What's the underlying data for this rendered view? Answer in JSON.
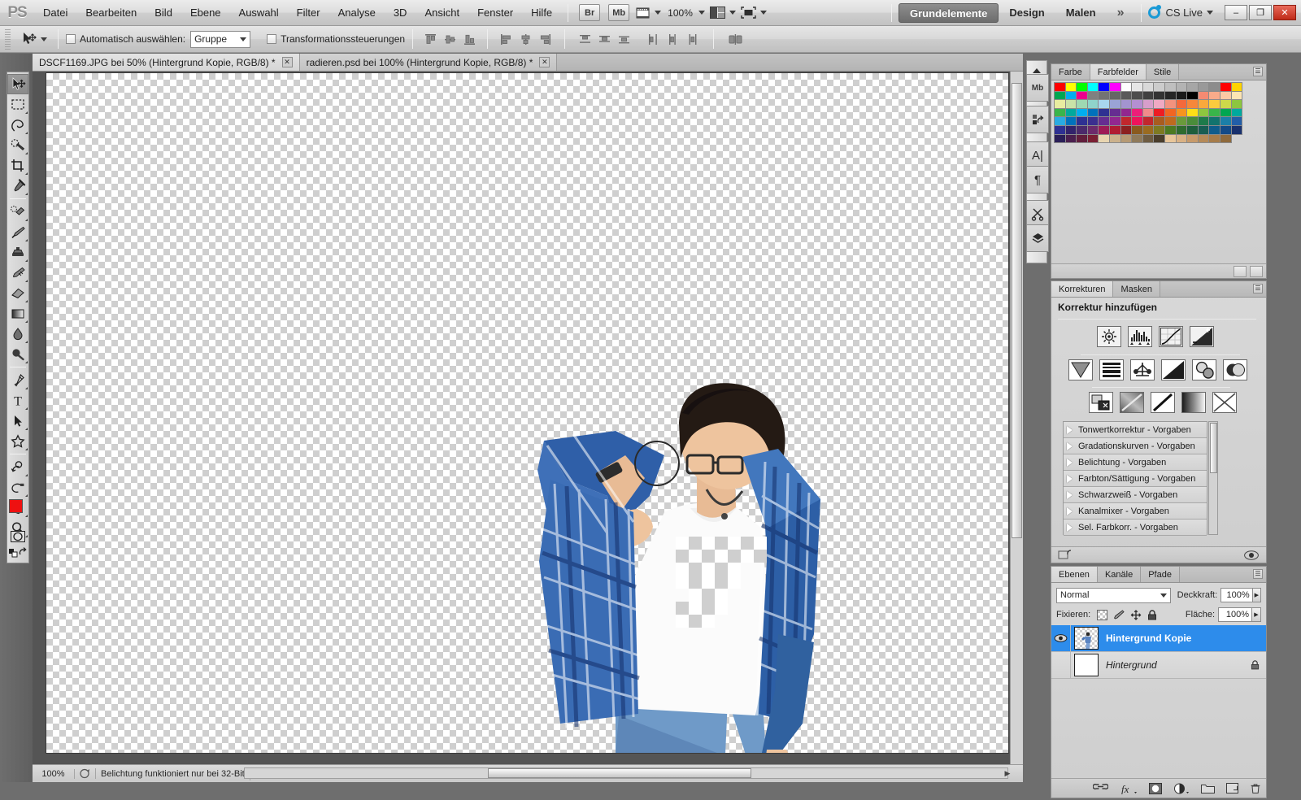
{
  "app": {
    "name": "Adobe Photoshop CS5",
    "logo_text": "PS"
  },
  "menubar": {
    "items": [
      "Datei",
      "Bearbeiten",
      "Bild",
      "Ebene",
      "Auswahl",
      "Filter",
      "Analyse",
      "3D",
      "Ansicht",
      "Fenster",
      "Hilfe"
    ],
    "bridge_label": "Br",
    "minibridge_label": "Mb",
    "zoom_level": "100%",
    "workspaces": [
      "Grundelemente",
      "Design",
      "Malen"
    ],
    "workspace_active": "Grundelemente",
    "more_workspaces": "»",
    "cs_live_label": "CS Live",
    "window_buttons": {
      "minimize": "–",
      "restore": "❐",
      "close": "✕"
    }
  },
  "optionsbar": {
    "tool_icon": "move-tool-icon",
    "auto_select_label": "Automatisch auswählen:",
    "auto_select_value": "Gruppe",
    "transform_controls_label": "Transformationssteuerungen",
    "align_icons": [
      "align-top-edges-icon",
      "align-vertical-centers-icon",
      "align-bottom-edges-icon",
      "align-left-edges-icon",
      "align-horizontal-centers-icon",
      "align-right-edges-icon",
      "distribute-top-icon",
      "distribute-vcenter-icon",
      "distribute-bottom-icon",
      "distribute-left-icon",
      "distribute-hcenter-icon",
      "distribute-right-icon",
      "auto-align-layers-icon"
    ]
  },
  "document_tabs": [
    {
      "title": "DSCF1169.JPG bei 50% (Hintergrund Kopie, RGB/8) *",
      "active": false,
      "close": "✕"
    },
    {
      "title": "radieren.psd bei 100% (Hintergrund Kopie, RGB/8) *",
      "active": true,
      "close": "✕"
    }
  ],
  "tools": {
    "groups": [
      [
        {
          "name": "move-tool",
          "selected": true,
          "sub": false
        },
        {
          "name": "rectangular-marquee-tool",
          "selected": false,
          "sub": true
        },
        {
          "name": "lasso-tool",
          "selected": false,
          "sub": true
        },
        {
          "name": "quick-selection-tool",
          "selected": false,
          "sub": true
        },
        {
          "name": "crop-tool",
          "selected": false,
          "sub": true
        },
        {
          "name": "eyedropper-tool",
          "selected": false,
          "sub": true
        }
      ],
      [
        {
          "name": "spot-healing-brush-tool",
          "selected": false,
          "sub": true
        },
        {
          "name": "brush-tool",
          "selected": false,
          "sub": true
        },
        {
          "name": "clone-stamp-tool",
          "selected": false,
          "sub": true
        },
        {
          "name": "history-brush-tool",
          "selected": false,
          "sub": true
        },
        {
          "name": "eraser-tool",
          "selected": false,
          "sub": true
        },
        {
          "name": "gradient-tool",
          "selected": false,
          "sub": true
        },
        {
          "name": "blur-tool",
          "selected": false,
          "sub": true
        },
        {
          "name": "dodge-tool",
          "selected": false,
          "sub": true
        }
      ],
      [
        {
          "name": "pen-tool",
          "selected": false,
          "sub": true
        },
        {
          "name": "type-tool",
          "selected": false,
          "sub": true
        },
        {
          "name": "path-selection-tool",
          "selected": false,
          "sub": true
        },
        {
          "name": "custom-shape-tool",
          "selected": false,
          "sub": true
        }
      ],
      [
        {
          "name": "3d-object-rotate-tool",
          "selected": false,
          "sub": true
        },
        {
          "name": "3d-camera-rotate-tool",
          "selected": false,
          "sub": true
        },
        {
          "name": "hand-tool",
          "selected": false,
          "sub": true
        },
        {
          "name": "zoom-tool",
          "selected": false,
          "sub": true
        }
      ]
    ],
    "foreground_color": "#ee1111",
    "background_color": "#ffffff",
    "quickmask_name": "quick-mask-mode"
  },
  "panels": {
    "color_group": {
      "tabs": [
        "Farbe",
        "Farbfelder",
        "Stile"
      ],
      "active_tab": "Farbfelder",
      "swatches": [
        "#ff0000",
        "#ffff00",
        "#00ff00",
        "#00ffff",
        "#0000ff",
        "#ff00ff",
        "#ffffff",
        "#e6e6e6",
        "#d9d9d9",
        "#cccccc",
        "#bfbfbf",
        "#b3b3b3",
        "#a6a6a6",
        "#999999",
        "#8c8c8c",
        "#ff0000",
        "#ffd400",
        "#00a651",
        "#00aeef",
        "#ec008c",
        "#808080",
        "#737373",
        "#666666",
        "#595959",
        "#4d4d4d",
        "#404040",
        "#333333",
        "#262626",
        "#1a1a1a",
        "#000000",
        "#f58a72",
        "#f9ab8a",
        "#fbc9a4",
        "#fde5b4",
        "#e8eda0",
        "#c9e3a8",
        "#9fd8b2",
        "#8fd4cb",
        "#a8d8ee",
        "#9aa3d6",
        "#a394d0",
        "#b48fd2",
        "#d79ecb",
        "#f0a9c3",
        "#f3927e",
        "#f4693c",
        "#f6873a",
        "#f9a93c",
        "#fbcb3e",
        "#cdd94a",
        "#8cc63f",
        "#39b54a",
        "#00a99d",
        "#00aeef",
        "#0071bc",
        "#2e3192",
        "#662d91",
        "#92278f",
        "#ed1e79",
        "#f28a8a",
        "#ed1c24",
        "#f26522",
        "#f7941e",
        "#ffde17",
        "#8dc63f",
        "#39b54a",
        "#00a651",
        "#00a99d",
        "#29abe2",
        "#0072bc",
        "#2e3192",
        "#3b2f8f",
        "#662d91",
        "#92278f",
        "#c1272d",
        "#ed145b",
        "#c1272d",
        "#a85c20",
        "#bf6a1f",
        "#6a9a3b",
        "#4a8c3a",
        "#1e7a4a",
        "#12736e",
        "#1b7fa8",
        "#225ea8",
        "#2e3192",
        "#32236b",
        "#4b2a6b",
        "#6d2b6b",
        "#9e1b56",
        "#b01b32",
        "#8c2020",
        "#8a5a1e",
        "#9a6b20",
        "#7e7a22",
        "#4c7a22",
        "#2f6b2f",
        "#1e5e3c",
        "#185d52",
        "#0f5c8c",
        "#134a87",
        "#19316e",
        "#2a1f58",
        "#4a1f4e",
        "#611e3c",
        "#7a1f33",
        "#e8d5b0",
        "#cbb18c",
        "#b69a74",
        "#8f7a5a",
        "#6e5c42",
        "#4a3e2c",
        "#e8c69a",
        "#d9b184",
        "#c79a6a",
        "#b58a58",
        "#a67c4a",
        "#8f6a3c"
      ],
      "swatch_columns": 19
    },
    "adjustments": {
      "tabs": [
        "Korrekturen",
        "Masken"
      ],
      "active_tab": "Korrekturen",
      "title": "Korrektur hinzufügen",
      "row1_icons": [
        "brightness-contrast-icon",
        "levels-icon",
        "curves-icon",
        "exposure-icon"
      ],
      "row2_icons": [
        "vibrance-icon",
        "hue-saturation-icon",
        "color-balance-icon",
        "black-white-icon",
        "photo-filter-icon",
        "channel-mixer-icon"
      ],
      "row3_icons": [
        "invert-icon",
        "posterize-icon",
        "threshold-icon",
        "gradient-map-icon",
        "selective-color-icon"
      ],
      "presets": [
        "Tonwertkorrektur - Vorgaben",
        "Gradationskurven - Vorgaben",
        "Belichtung - Vorgaben",
        "Farbton/Sättigung - Vorgaben",
        "Schwarzweiß - Vorgaben",
        "Kanalmixer - Vorgaben",
        "Sel. Farbkorr. - Vorgaben"
      ]
    },
    "layers": {
      "tabs": [
        "Ebenen",
        "Kanäle",
        "Pfade"
      ],
      "active_tab": "Ebenen",
      "blend_mode": "Normal",
      "opacity_label": "Deckkraft:",
      "opacity_value": "100%",
      "lock_label": "Fixieren:",
      "lock_icons": [
        "lock-transparent-pixels-icon",
        "lock-image-pixels-icon",
        "lock-position-icon",
        "lock-all-icon"
      ],
      "fill_label": "Fläche:",
      "fill_value": "100%",
      "rows": [
        {
          "name": "Hintergrund Kopie",
          "visible": true,
          "selected": true,
          "locked": false,
          "thumb": "transparent-person-thumb"
        },
        {
          "name": "Hintergrund",
          "visible": false,
          "selected": false,
          "locked": true,
          "thumb": "white-thumb"
        }
      ],
      "footer_icons": [
        "link-layers-icon",
        "layer-style-fx-icon",
        "add-layer-mask-icon",
        "new-adjustment-layer-icon",
        "new-group-icon",
        "new-layer-icon"
      ]
    }
  },
  "statusbar": {
    "zoom": "100%",
    "message": "Belichtung funktioniert nur bei 32-Bit",
    "doc_icon": "doc-info-icon",
    "expand_arrow": "▶"
  },
  "canvas": {
    "content_description": "cut-out photo of a young man in plaid shirt on transparent background",
    "eraser_cursor": "round-eraser-cursor"
  }
}
